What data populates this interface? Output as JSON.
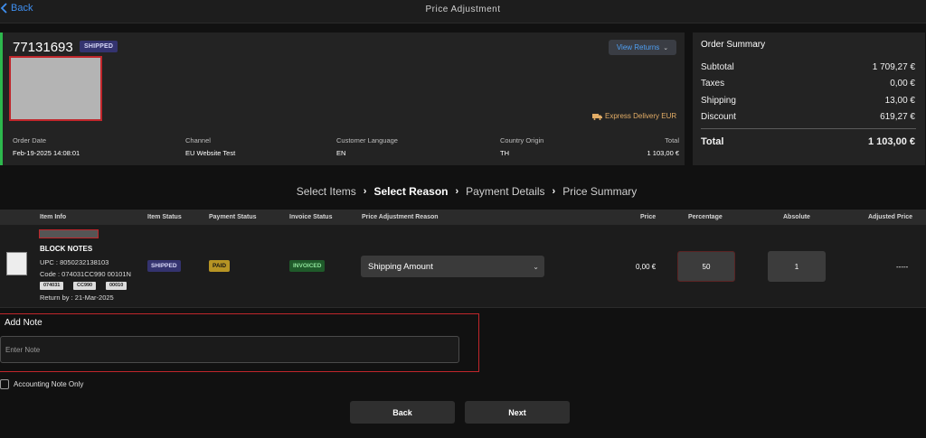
{
  "header": {
    "back_label": "Back",
    "title": "Price Adjustment"
  },
  "order": {
    "id": "77131693",
    "status_badge": "SHIPPED",
    "view_returns_label": "View Returns",
    "delivery": "Express Delivery EUR",
    "meta": [
      {
        "label": "Order Date",
        "value": "Feb-19-2025 14:08:01"
      },
      {
        "label": "Channel",
        "value": "EU Website Test"
      },
      {
        "label": "Customer Language",
        "value": "EN"
      },
      {
        "label": "Country Origin",
        "value": "TH"
      },
      {
        "label": "Total",
        "value": "1 103,00 €"
      }
    ]
  },
  "summary": {
    "title": "Order Summary",
    "rows": [
      {
        "label": "Subtotal",
        "value": "1 709,27 €"
      },
      {
        "label": "Taxes",
        "value": "0,00 €"
      },
      {
        "label": "Shipping",
        "value": "13,00 €"
      },
      {
        "label": "Discount",
        "value": "619,27 €"
      }
    ],
    "total_label": "Total",
    "total_value": "1 103,00 €"
  },
  "steps": [
    "Select Items",
    "Select Reason",
    "Payment Details",
    "Price Summary"
  ],
  "active_step": "Select Reason",
  "table": {
    "headers": [
      "Item Info",
      "Item Status",
      "Payment Status",
      "Invoice Status",
      "Price Adjustment Reason",
      "Price",
      "Percentage",
      "Absolute",
      "Adjusted Price"
    ],
    "row": {
      "name": "BLOCK NOTES",
      "upc": "UPC : 8050232138103",
      "code": "Code : 074031CC990 00101N",
      "chips": [
        "074031",
        "CC990",
        "00010"
      ],
      "return_by": "Return by : 21-Mar-2025",
      "item_status": "SHIPPED",
      "payment_status": "PAID",
      "invoice_status": "INVOICED",
      "reason": "Shipping Amount",
      "price": "0,00 €",
      "percentage": "50",
      "absolute": "1",
      "adjusted_price": "-----"
    }
  },
  "note": {
    "title": "Add Note",
    "placeholder": "Enter Note",
    "accounting_label": "Accounting Note Only"
  },
  "buttons": {
    "back": "Back",
    "next": "Next"
  },
  "colors": {
    "accent_green": "#2db84d",
    "link_blue": "#4fa0f4",
    "highlight_red": "#c0262b"
  }
}
